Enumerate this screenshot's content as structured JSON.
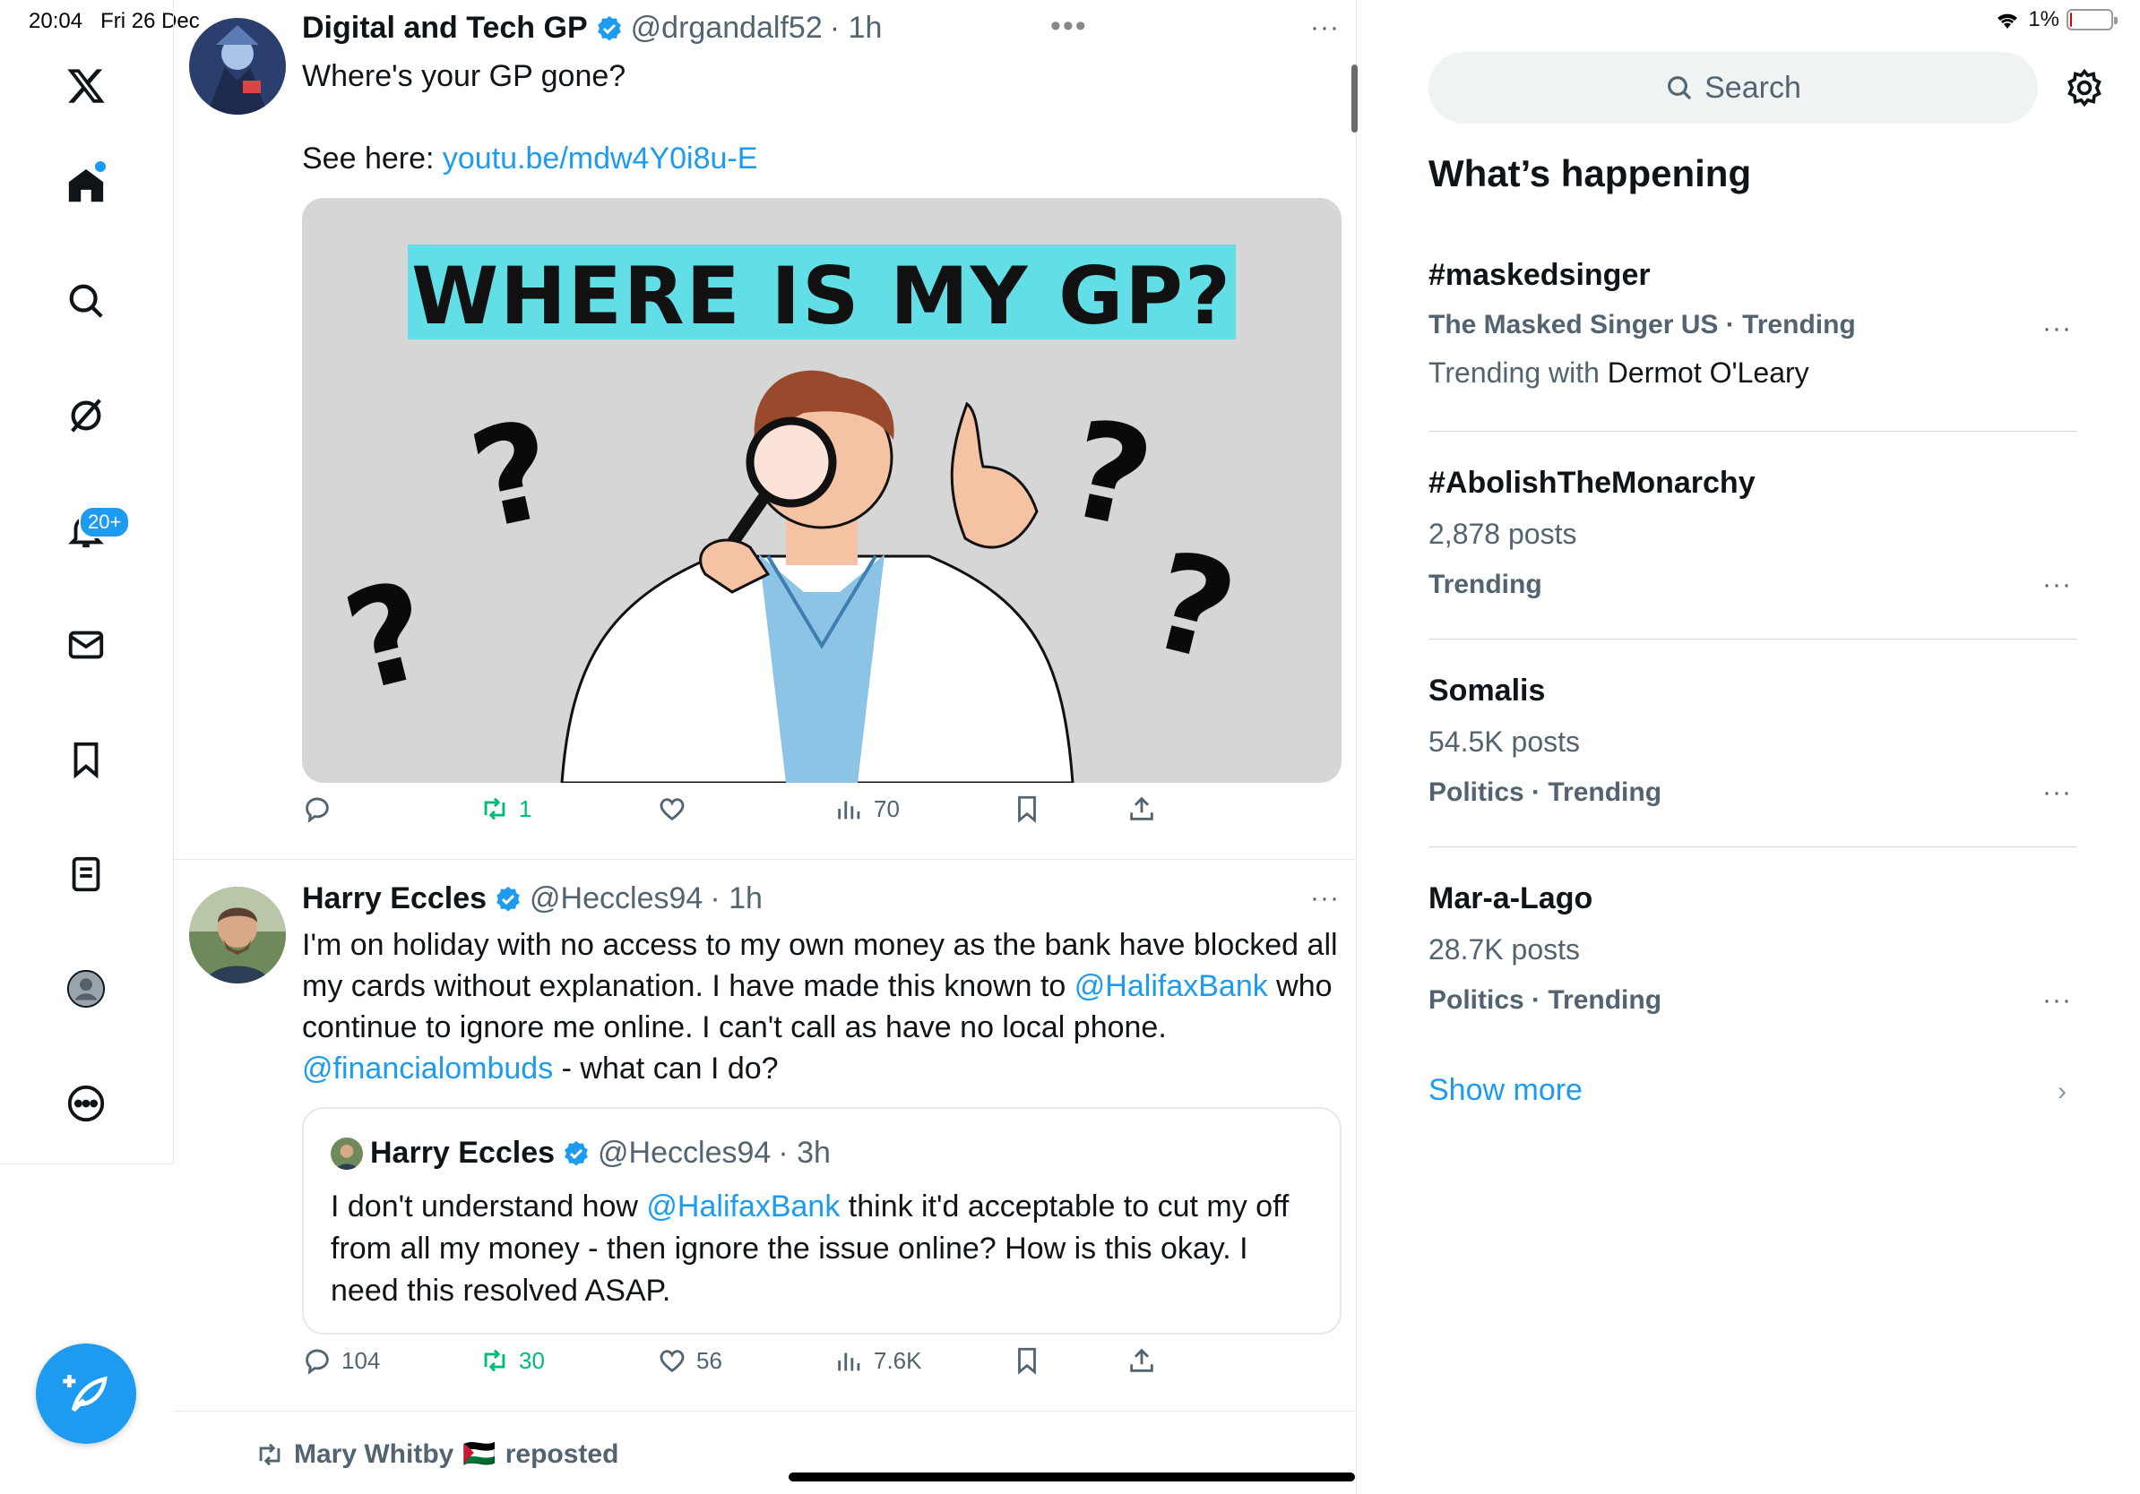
{
  "status": {
    "time": "20:04",
    "date": "Fri 26 Dec",
    "battery": "1%"
  },
  "nav": {
    "notifications_badge": "20+"
  },
  "tweets": [
    {
      "name": "Digital and Tech GP",
      "handle": "@drgandalf52",
      "time": "· 1h",
      "text_line1": "Where's your GP gone?",
      "text_line2_prefix": "See here: ",
      "link": "youtu.be/mdw4Y0i8u-E",
      "media_title": "WHERE IS MY GP?",
      "replies": "",
      "retweets": "1",
      "likes": "",
      "views": "70"
    },
    {
      "name": "Harry Eccles",
      "handle": "@Heccles94",
      "time": "· 1h",
      "text_a": "I'm on holiday with no access to my own money as the bank have blocked all my cards without explanation. I have made this known to ",
      "mention1": "@HalifaxBank",
      "text_b": " who continue to ignore me online. I can't call as have no local phone. ",
      "mention2": "@financialombuds",
      "text_c": " - what can I do?",
      "replies": "104",
      "retweets": "30",
      "likes": "56",
      "views": "7.6K",
      "quote": {
        "name": "Harry Eccles",
        "handle": "@Heccles94",
        "time": "· 3h",
        "text_a": "I don't understand how ",
        "mention": "@HalifaxBank",
        "text_b": " think it'd acceptable to cut my off from all my money - then ignore the issue online? How is this okay. I need this resolved ASAP."
      }
    }
  ],
  "repost": {
    "user": "Mary Whitby",
    "flag": "🇵🇸",
    "label": "reposted"
  },
  "sidebar": {
    "search_placeholder": "Search",
    "heading": "What’s happening",
    "trends": [
      {
        "title": "#maskedsinger",
        "meta": "The Masked Singer US · Trending",
        "extra_prefix": "Trending with ",
        "extra_name": "Dermot O'Leary"
      },
      {
        "title": "#AbolishTheMonarchy",
        "posts": "2,878 posts",
        "meta": "Trending"
      },
      {
        "title": "Somalis",
        "posts": "54.5K posts",
        "meta": "Politics · Trending"
      },
      {
        "title": "Mar-a-Lago",
        "posts": "28.7K posts",
        "meta": "Politics · Trending"
      }
    ],
    "show_more": "Show more"
  },
  "colors": {
    "accent": "#1d9bf0",
    "retweet": "#00ba7c",
    "muted": "#536471"
  }
}
